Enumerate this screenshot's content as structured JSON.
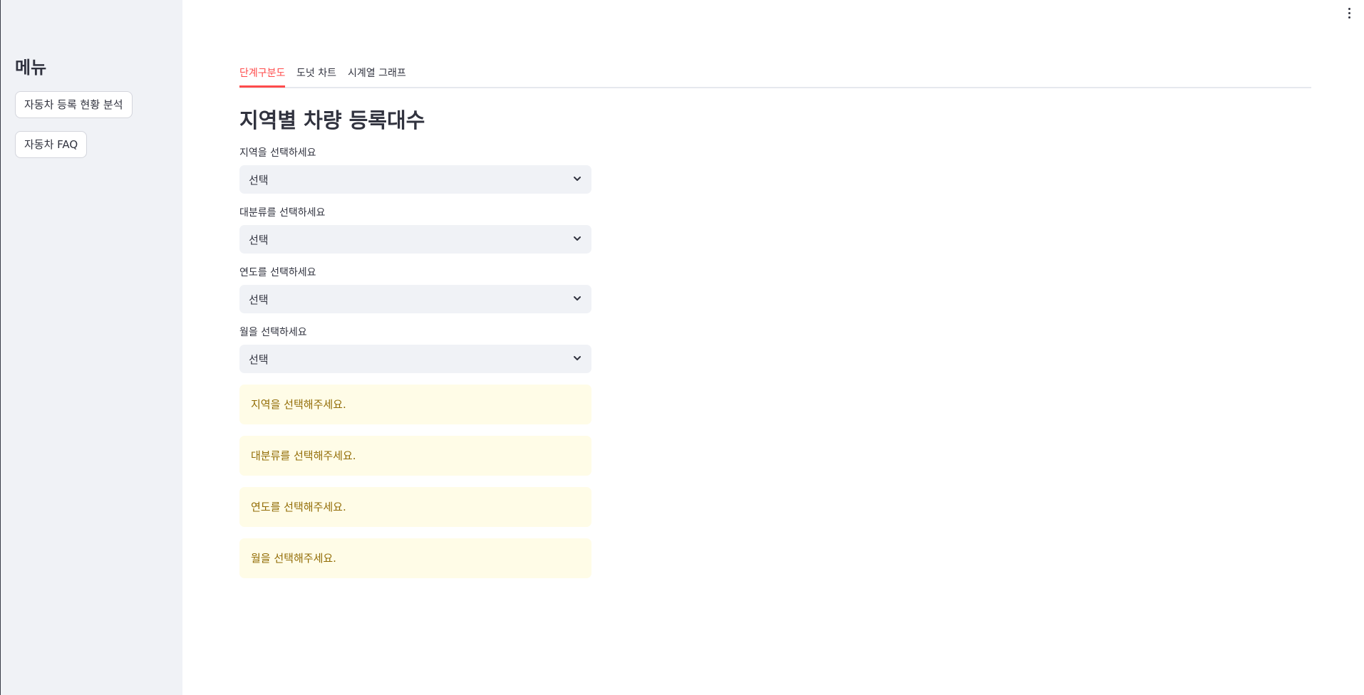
{
  "sidebar": {
    "title": "메뉴",
    "buttons": [
      {
        "label": "자동차 등록 현황 분석"
      },
      {
        "label": "자동차 FAQ"
      }
    ]
  },
  "main": {
    "tabs": [
      {
        "label": "단계구분도",
        "active": true
      },
      {
        "label": "도넛 차트",
        "active": false
      },
      {
        "label": "시계열 그래프",
        "active": false
      }
    ],
    "title": "지역별 차량 등록대수",
    "fields": [
      {
        "label": "지역을 선택하세요",
        "value": "선택"
      },
      {
        "label": "대분류를 선택하세요",
        "value": "선택"
      },
      {
        "label": "연도를 선택하세요",
        "value": "선택"
      },
      {
        "label": "월을 선택하세요",
        "value": "선택"
      }
    ],
    "warnings": [
      {
        "text": "지역을 선택해주세요."
      },
      {
        "text": "대분류를 선택해주세요."
      },
      {
        "text": "연도를 선택해주세요."
      },
      {
        "text": "월을 선택해주세요."
      }
    ]
  },
  "icons": {
    "main_menu": "vertical-ellipsis-icon",
    "select_arrow": "chevron-down-icon"
  },
  "colors": {
    "accent": "#ff4b4b",
    "sidebar_bg": "#f0f2f6",
    "select_bg": "#f0f2f6",
    "warning_bg": "#fffce7",
    "warning_text": "#926c05",
    "text": "#31333f"
  }
}
